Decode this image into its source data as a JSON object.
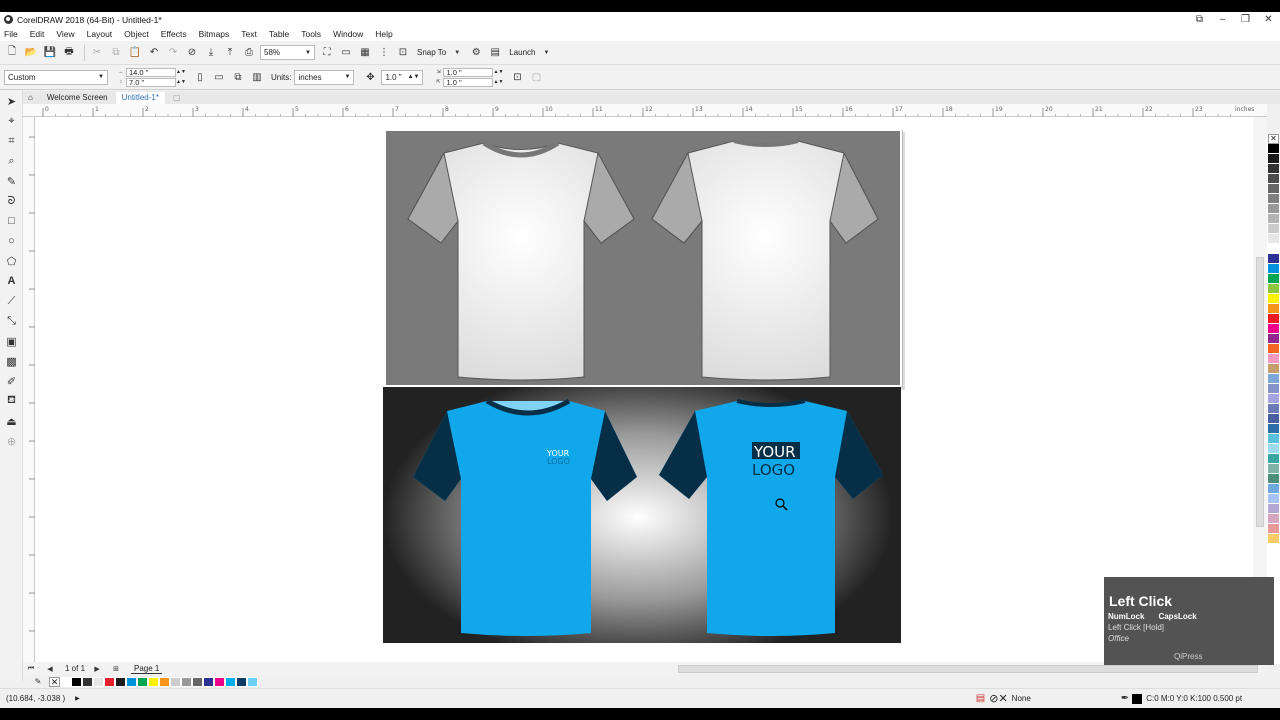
{
  "window": {
    "title": "CorelDRAW 2018 (64-Bit) - Untitled-1*"
  },
  "menu": [
    "File",
    "Edit",
    "View",
    "Layout",
    "Object",
    "Effects",
    "Bitmaps",
    "Text",
    "Table",
    "Tools",
    "Window",
    "Help"
  ],
  "toolbar1": {
    "zoom": "58%",
    "snap_to": "Snap To",
    "launch": "Launch"
  },
  "toolbar2": {
    "preset": "Custom",
    "width": "14.0 \"",
    "height": "7.0 \"",
    "units_label": "Units:",
    "units": "inches",
    "nudge": "1.0 \"",
    "dup_x": "1.0 \"",
    "dup_y": "1.0 \""
  },
  "tabs": {
    "welcome": "Welcome Screen",
    "doc": "Untitled-1*"
  },
  "ruler": {
    "h_ticks": [
      "0",
      "1",
      "2",
      "3",
      "4",
      "5",
      "6",
      "7",
      "8",
      "9",
      "10",
      "11",
      "12",
      "13",
      "14",
      "15",
      "16",
      "17",
      "18",
      "19",
      "20",
      "21",
      "22",
      "23"
    ],
    "units": "inches"
  },
  "artwork": {
    "logo_line1": "YOUR",
    "logo_line2": "LOGO"
  },
  "docnav": {
    "page_of": "1  of  1",
    "page_tab": "Page 1"
  },
  "status": {
    "coords": "(10.684, -3.038 )",
    "fill": "None",
    "outline": "C:0 M:0 Y:0 K:100  0.500 pt"
  },
  "overlay": {
    "title": "Left Click",
    "numlock": "NumLock",
    "capslock": "CapsLock",
    "hold": "Left Click [Hold]",
    "office": "Office",
    "brand": "QiPress"
  },
  "colors": {
    "palette_h": [
      "#ffffff",
      "#000000",
      "#333333",
      "#e6e6e6",
      "#e5202e",
      "#1b1b1b",
      "#0093dd",
      "#00a651",
      "#fff200",
      "#f7941d",
      "#cccccc",
      "#999999",
      "#666666",
      "#2e3192",
      "#ec008c",
      "#00aeef",
      "#0d3b66",
      "#6dcff6"
    ],
    "palette_v": [
      "#000000",
      "#1a1a1a",
      "#333333",
      "#4d4d4d",
      "#666666",
      "#808080",
      "#999999",
      "#b3b3b3",
      "#cccccc",
      "#e6e6e6",
      "#ffffff",
      "#2e3192",
      "#0093dd",
      "#00a651",
      "#8dc63f",
      "#fff200",
      "#f7941d",
      "#ed1c24",
      "#ec008c",
      "#92278f",
      "#f26522",
      "#f49ac1",
      "#c69c6d",
      "#7da7d9",
      "#8493ca",
      "#a3a3e0",
      "#6c7ab5",
      "#4a5fa0",
      "#2f6da8",
      "#5bc0de",
      "#9edbf0",
      "#3aa6a6",
      "#7fb3a8",
      "#4e8f7a",
      "#6fa8dc",
      "#a4c2f4",
      "#b4a7d6",
      "#d5a6bd",
      "#ea9999",
      "#f9cb66"
    ]
  }
}
